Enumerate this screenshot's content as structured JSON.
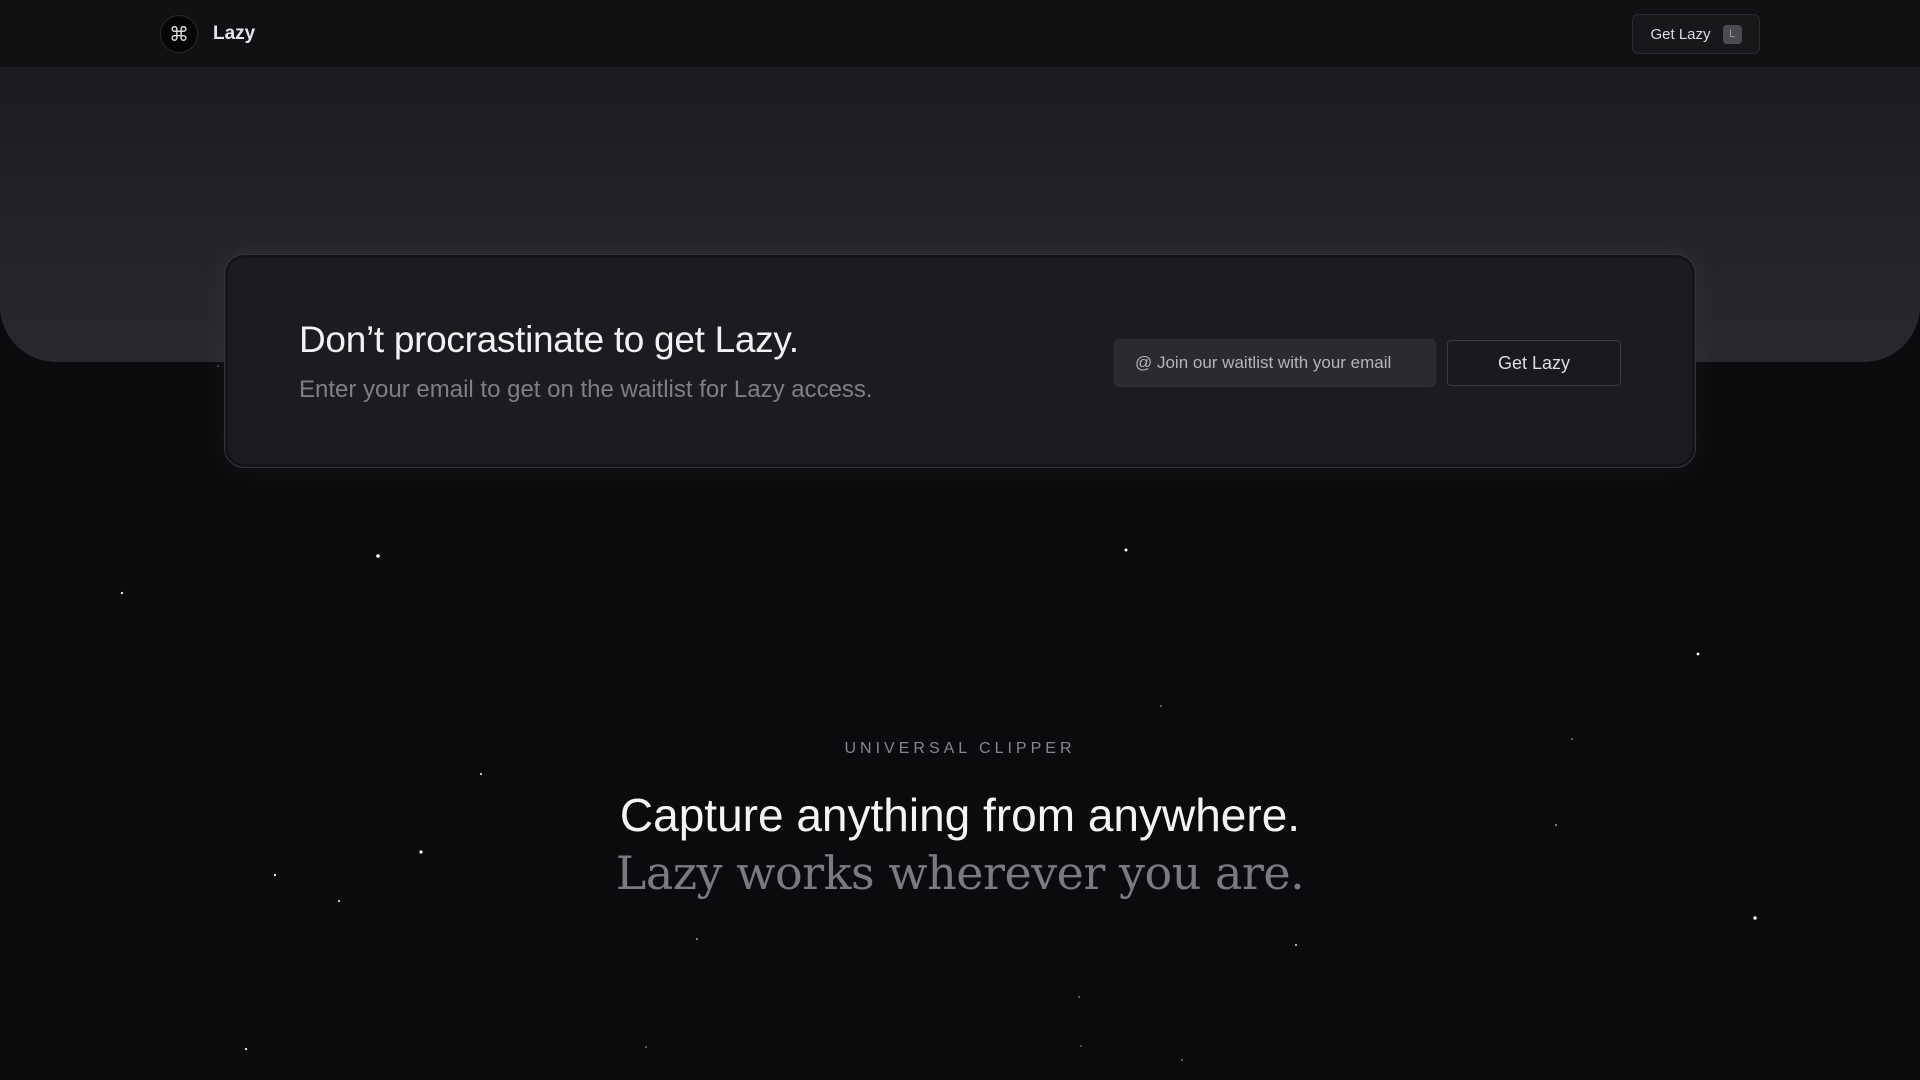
{
  "nav": {
    "brand": "Lazy",
    "logo_icon": "command-icon",
    "cta_label": "Get Lazy",
    "cta_shortcut": "L"
  },
  "hero_card": {
    "title": "Don’t procrastinate to get Lazy.",
    "subtitle": "Enter your email to get on the waitlist for Lazy access.",
    "email_placeholder": "@ Join our waitlist with your email",
    "submit_label": "Get Lazy"
  },
  "section": {
    "eyebrow": "UNIVERSAL CLIPPER",
    "title": "Capture anything from anywhere.",
    "subtitle": "Lazy works wherever you are."
  },
  "colors": {
    "background": "#0b0b0d",
    "navbar": "#111114",
    "card": "#1c1c20",
    "text_primary": "#f2f2f4",
    "text_muted": "#7e7e86"
  }
}
